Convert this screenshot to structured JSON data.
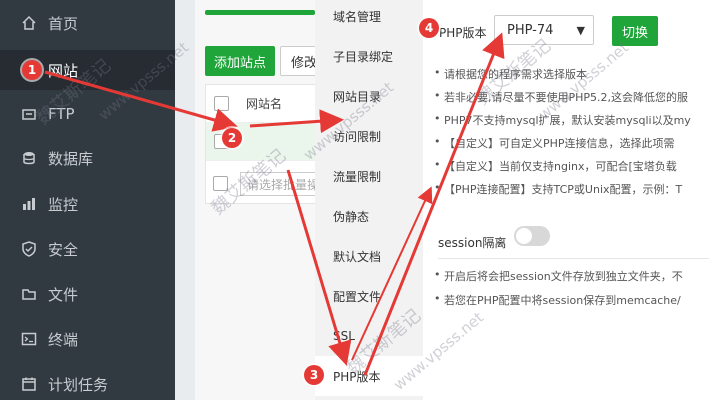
{
  "sidebar": {
    "items": [
      {
        "label": "首页",
        "icon": "home-icon"
      },
      {
        "label": "网站",
        "icon": "globe-icon",
        "active": true
      },
      {
        "label": "FTP",
        "icon": "ftp-icon"
      },
      {
        "label": "数据库",
        "icon": "database-icon"
      },
      {
        "label": "监控",
        "icon": "monitor-icon"
      },
      {
        "label": "安全",
        "icon": "shield-icon"
      },
      {
        "label": "文件",
        "icon": "folder-icon"
      },
      {
        "label": "终端",
        "icon": "terminal-icon"
      },
      {
        "label": "计划任务",
        "icon": "calendar-icon"
      }
    ]
  },
  "website_list": {
    "add_button": "添加站点",
    "modify_button": "修改",
    "column_site_name": "网站名",
    "batch_placeholder": "请选择批量操"
  },
  "settings_menu": {
    "items": [
      {
        "label": "域名管理"
      },
      {
        "label": "子目录绑定"
      },
      {
        "label": "网站目录"
      },
      {
        "label": "访问限制"
      },
      {
        "label": "流量限制"
      },
      {
        "label": "伪静态"
      },
      {
        "label": "默认文档"
      },
      {
        "label": "配置文件"
      },
      {
        "label": "SSL"
      },
      {
        "label": "PHP版本",
        "active": true
      }
    ]
  },
  "php": {
    "label": "PHP版本",
    "selected": "PHP-74",
    "switch_button": "切换",
    "tips": [
      "请根据您的程序需求选择版本",
      "若非必要,请尽量不要使用PHP5.2,这会降低您的服",
      "PHP7不支持mysql扩展，默认安装mysqli以及my",
      "【自定义】可自定义PHP连接信息，选择此项需",
      "【自定义】当前仅支持nginx，可配合[宝塔负载",
      "【PHP连接配置】支持TCP或Unix配置，示例：T"
    ]
  },
  "session": {
    "label": "session隔离",
    "enabled": false,
    "tips": [
      "开启后将会把session文件存放到独立文件夹，不",
      "若您在PHP配置中将session保存到memcache/"
    ]
  },
  "annotations": [
    "1",
    "2",
    "3",
    "4"
  ],
  "watermark": {
    "text_cn": "魏艾斯笔记",
    "text_url": "www.vpsss.net"
  },
  "colors": {
    "sidebar_bg": "#313a40",
    "accent_green": "#20a53a",
    "annotation_red": "#e53935"
  }
}
